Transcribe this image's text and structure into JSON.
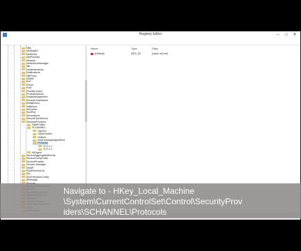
{
  "window": {
    "title": "Registry Editor",
    "minimize_icon": "minimize-icon",
    "maximize_icon": "maximize-icon",
    "close_icon": "close-icon"
  },
  "menu": [
    "File",
    "Edit",
    "View",
    "Favorites",
    "Help"
  ],
  "tree": {
    "scroll_position": 0.28,
    "items": [
      {
        "label": "Ntfs",
        "level": 3
      },
      {
        "label": "NetDiagFx",
        "level": 3
      },
      {
        "label": "NetEnum",
        "level": 3
      },
      {
        "label": "NetProvider",
        "level": 3
      },
      {
        "label": "Network",
        "level": 3
      },
      {
        "label": "NetworkUxManager",
        "level": 3
      },
      {
        "label": "Nls",
        "level": 3
      },
      {
        "label": "NodeInterfaces",
        "level": 3
      },
      {
        "label": "Notifications",
        "level": 3
      },
      {
        "label": "NsiProxy",
        "level": 3
      },
      {
        "label": "NUMA",
        "level": 3
      },
      {
        "label": "PnP",
        "level": 3
      },
      {
        "label": "Power",
        "level": 3
      },
      {
        "label": "Print",
        "level": 3
      },
      {
        "label": "PriorityControl",
        "level": 3
      },
      {
        "label": "ProductOptions",
        "level": 3
      },
      {
        "label": "RadioManagement",
        "level": 3
      },
      {
        "label": "Remote Assistance",
        "level": 3
      },
      {
        "label": "RetailDemo",
        "level": 3
      },
      {
        "label": "SafeBoot",
        "level": 3
      },
      {
        "label": "ScEvents",
        "level": 3
      },
      {
        "label": "ScsiPort",
        "level": 3
      },
      {
        "label": "SecureBoot",
        "level": 3
      },
      {
        "label": "SecurePipeServers",
        "level": 3
      },
      {
        "label": "SecurityProviders",
        "level": 3
      },
      {
        "label": "SaslProfiles",
        "level": 4
      },
      {
        "label": "SCHANNEL",
        "level": 4
      },
      {
        "label": "Ciphers",
        "level": 5
      },
      {
        "label": "CipherSuites",
        "level": 5
      },
      {
        "label": "Hashes",
        "level": 5
      },
      {
        "label": "KeyExchangeAlgorithms",
        "level": 5
      },
      {
        "label": "Protocols",
        "level": 5,
        "selected": true
      },
      {
        "label": "TLS 1.1",
        "level": 6
      },
      {
        "label": "TLS 1.2",
        "level": 6
      },
      {
        "label": "WDigest",
        "level": 4
      },
      {
        "label": "ServiceAggregatedEvents",
        "level": 3
      },
      {
        "label": "ServiceGroupOrder",
        "level": 3
      },
      {
        "label": "ServiceProvider",
        "level": 3
      },
      {
        "label": "Session Manager",
        "level": 3
      },
      {
        "label": "SNMP",
        "level": 3
      },
      {
        "label": "SQMServiceList",
        "level": 3
      },
      {
        "label": "Srp",
        "level": 3
      },
      {
        "label": "SrpExtensionConfig",
        "level": 3
      },
      {
        "label": "StillImage",
        "level": 3
      },
      {
        "label": "Storage",
        "level": 3
      },
      {
        "label": "StorageManagement",
        "level": 3
      },
      {
        "label": "StorPort",
        "level": 3
      },
      {
        "label": "SystemInformation",
        "level": 3
      },
      {
        "label": "SystemResources",
        "level": 3
      },
      {
        "label": "TabletPC",
        "level": 3
      },
      {
        "label": "Terminal Server",
        "level": 3
      },
      {
        "label": "TimeZoneInformation",
        "level": 3
      },
      {
        "label": "Ubpm",
        "level": 3
      },
      {
        "label": "UnitedVideo",
        "level": 3
      },
      {
        "label": "usb",
        "level": 3
      },
      {
        "label": "usbflags",
        "level": 3
      },
      {
        "label": "usbstor",
        "level": 3
      }
    ]
  },
  "values": {
    "columns": [
      "Name",
      "Type",
      "Data"
    ],
    "rows": [
      {
        "name": "(Default)",
        "type": "REG_SZ",
        "data": "(value not set)",
        "icon": "string-value-icon"
      }
    ]
  },
  "caption": "Navigate to - HKey_Local_Machine\n\\System\\CurrentControlSet\\Control\\SecurityProv\niders\\SCHANNEL\\Protocols"
}
